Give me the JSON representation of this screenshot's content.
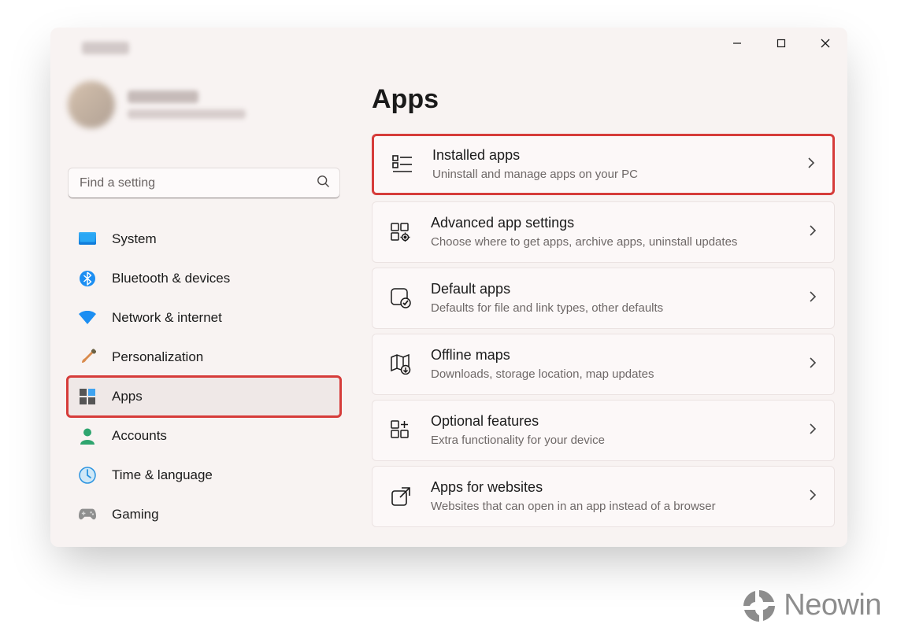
{
  "window": {
    "type": "settings"
  },
  "search": {
    "placeholder": "Find a setting"
  },
  "sidebar": {
    "items": [
      {
        "label": "System"
      },
      {
        "label": "Bluetooth & devices"
      },
      {
        "label": "Network & internet"
      },
      {
        "label": "Personalization"
      },
      {
        "label": "Apps",
        "active": true
      },
      {
        "label": "Accounts"
      },
      {
        "label": "Time & language"
      },
      {
        "label": "Gaming"
      }
    ]
  },
  "main": {
    "title": "Apps",
    "cards": [
      {
        "title": "Installed apps",
        "subtitle": "Uninstall and manage apps on your PC",
        "highlight": true
      },
      {
        "title": "Advanced app settings",
        "subtitle": "Choose where to get apps, archive apps, uninstall updates"
      },
      {
        "title": "Default apps",
        "subtitle": "Defaults for file and link types, other defaults"
      },
      {
        "title": "Offline maps",
        "subtitle": "Downloads, storage location, map updates"
      },
      {
        "title": "Optional features",
        "subtitle": "Extra functionality for your device"
      },
      {
        "title": "Apps for websites",
        "subtitle": "Websites that can open in an app instead of a browser"
      }
    ]
  },
  "watermark": {
    "text": "Neowin"
  }
}
